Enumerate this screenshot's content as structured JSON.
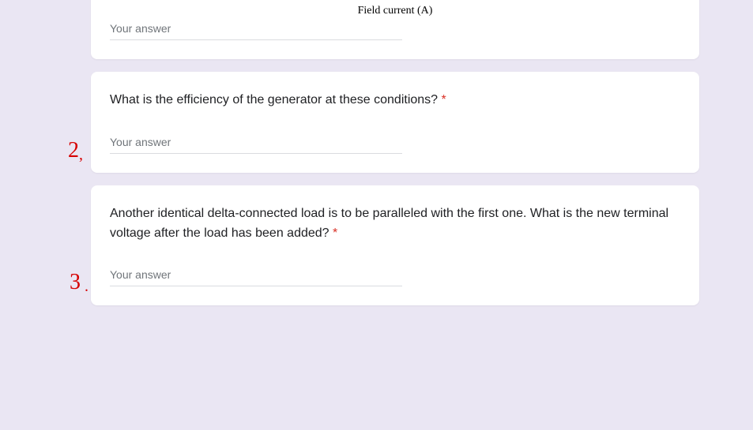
{
  "annotations": {
    "q2": "2",
    "q3": "3"
  },
  "card1": {
    "chart_x_label": "Field current (A)",
    "answer_placeholder": "Your answer"
  },
  "card2": {
    "question": "What is the efficiency of the generator at these conditions? ",
    "required": "*",
    "answer_placeholder": "Your answer"
  },
  "card3": {
    "question": "Another identical delta-connected load is to be paralleled with the first one. What is the new terminal voltage after the load has been added? ",
    "required": "*",
    "answer_placeholder": "Your answer"
  }
}
